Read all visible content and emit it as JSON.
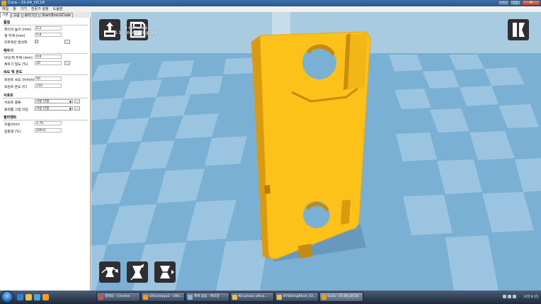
{
  "window": {
    "title": "Cura - 15.04_OC16"
  },
  "window_controls": {
    "minimize": "–",
    "maximize": "□",
    "close": "✕"
  },
  "menu": [
    "파일",
    "툴",
    "기기",
    "전문가 설정",
    "도움말"
  ],
  "tabs": [
    "기본",
    "고급",
    "플러그인",
    "Start/End-GCode"
  ],
  "panel": {
    "quality": {
      "title": "품질",
      "layer_height": {
        "label": "레이어 높이 (mm)",
        "value": "0.2"
      },
      "shell": {
        "label": "쉘 두께 (mm)",
        "value": "0.8"
      },
      "retraction": {
        "label": "리트랙션 활성화",
        "checked": "✓"
      }
    },
    "fill": {
      "title": "채우기",
      "bottom_top": {
        "label": "바닥/위 두께 (mm)",
        "value": "0.8"
      },
      "density": {
        "label": "채우기 밀도 (%)",
        "value": "20"
      }
    },
    "speed": {
      "title": "속도 및 온도",
      "print_speed": {
        "label": "프린트 속도 (mm/s)",
        "value": "50"
      },
      "print_temp": {
        "label": "프린트 온도 (C)",
        "value": "210"
      }
    },
    "support": {
      "title": "서포트",
      "support_type": {
        "label": "서포트 종류",
        "value": "사용 안함"
      },
      "adhesion": {
        "label": "플랫폼 고정 타입",
        "value": "사용 안함"
      }
    },
    "filament": {
      "title": "필라멘트",
      "diameter": {
        "label": "지름(mm)",
        "value": "1.75"
      },
      "flow": {
        "label": "압출량 (%)",
        "value": "100.0"
      }
    },
    "dots": "..."
  },
  "viewport": {
    "print_time": "6 minutes",
    "print_usage": "0.15 meter 0 gram",
    "model_color": "#fdc21a",
    "background_color": "#7ab0d4"
  },
  "taskbar": {
    "tasks": [
      "검색용 - Chrome",
      "Ulticampyx2 - Ultic...",
      "제목 없음 - 메모장",
      "Kit piezas ultica...",
      "XYSlidingBlock_V2...",
      "Cura - 15.04_OC16"
    ],
    "clock": "오전 6:15"
  }
}
